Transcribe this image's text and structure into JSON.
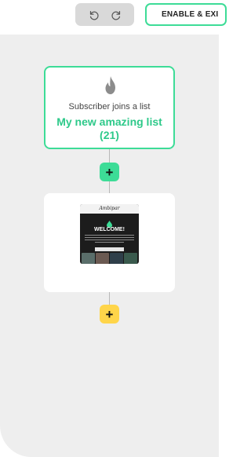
{
  "toolbar": {
    "undo_icon": "undo-icon",
    "redo_icon": "redo-icon",
    "enable_label": "ENABLE & EXI"
  },
  "trigger": {
    "icon": "flame-icon",
    "label": "Subscriber joins a list",
    "list_name": "My new amazing list",
    "count": "(21)"
  },
  "email_preview": {
    "logo_text": "Ambipar",
    "heading": "WELCOME!"
  },
  "colors": {
    "accent_green": "#3ddc97",
    "list_text_green": "#2ec98a",
    "add_yellow": "#ffd54a",
    "canvas": "#eeeeee"
  }
}
